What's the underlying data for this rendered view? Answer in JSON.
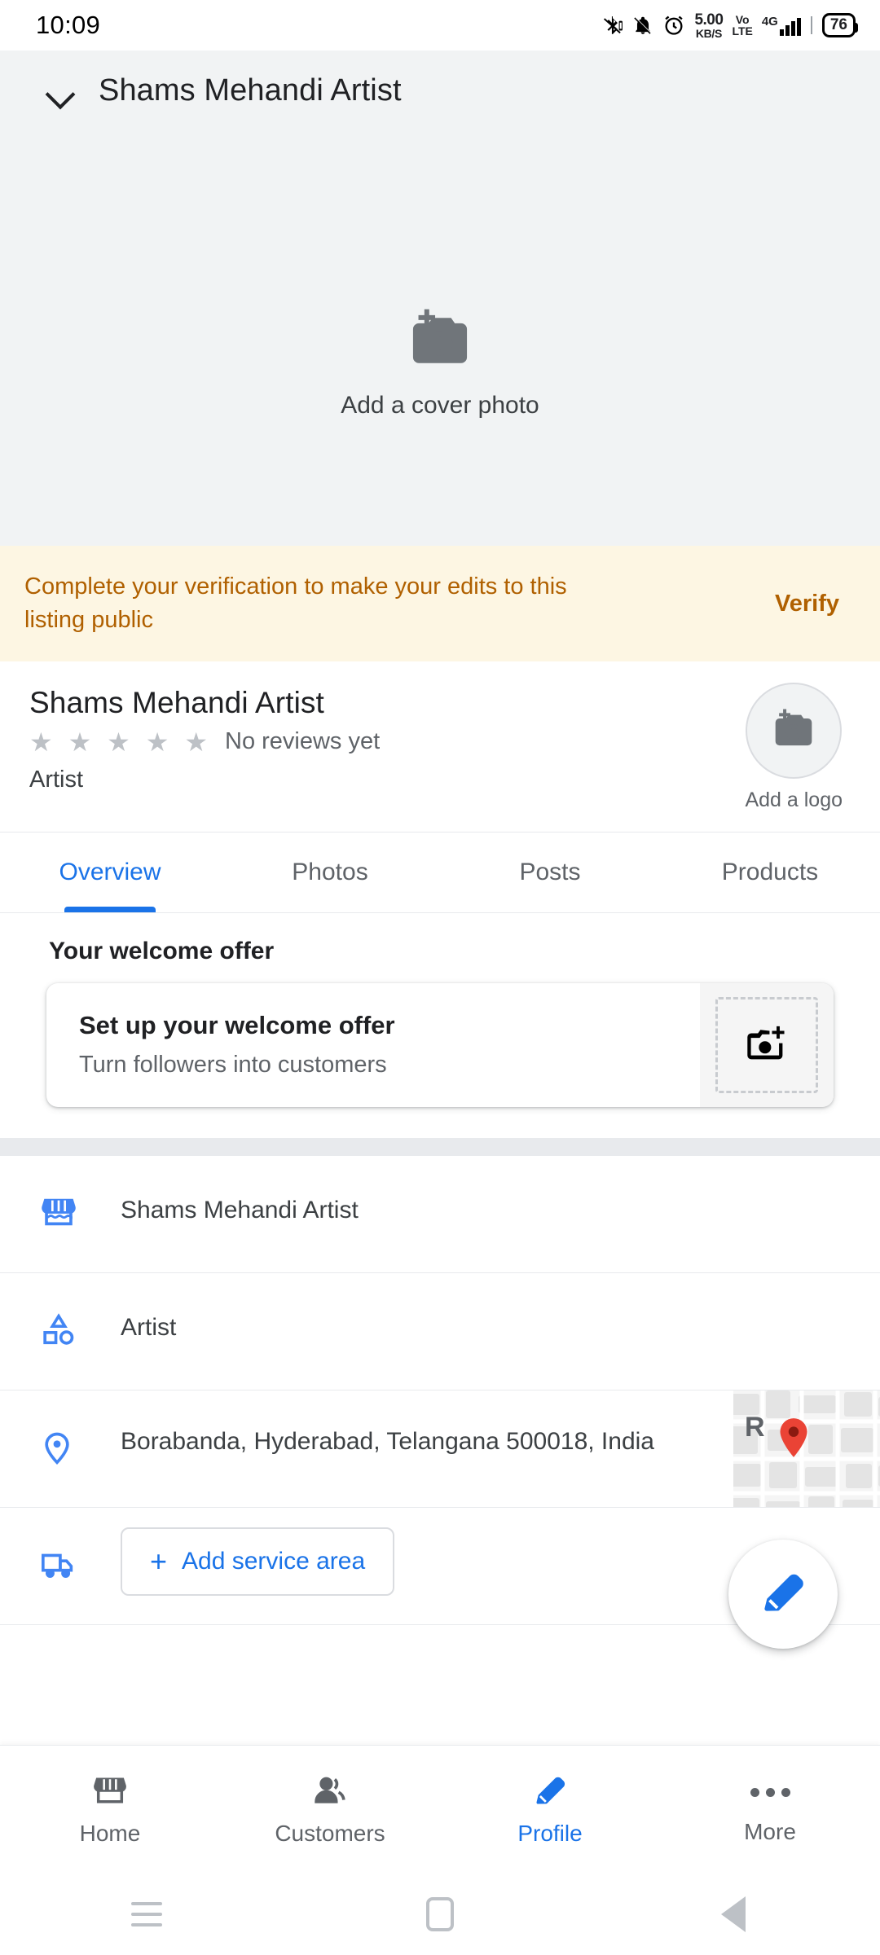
{
  "status_bar": {
    "time": "10:09",
    "network_speed_value": "5.00",
    "network_speed_unit": "KB/S",
    "volte_top": "Vo",
    "volte_bottom": "LTE",
    "network_type": "4G",
    "battery": "76",
    "icons": [
      "bluetooth-icon",
      "silent-bell-icon",
      "alarm-icon",
      "signal-bars-icon",
      "battery-icon"
    ]
  },
  "app_bar": {
    "title": "Shams Mehandi Artist",
    "chevron": "chevron-down-icon"
  },
  "cover": {
    "cta_label": "Add a cover photo",
    "icon": "add-photo-camera-icon",
    "background": "#f1f3f4"
  },
  "verification_banner": {
    "message": "Complete your verification to make your edits to this listing public",
    "action_label": "Verify",
    "background": "#fdf6e3",
    "text_color": "#b06000"
  },
  "business_header": {
    "name": "Shams Mehandi Artist",
    "stars": "★ ★ ★ ★ ★",
    "rating_text": "No reviews yet",
    "category": "Artist",
    "logo_caption": "Add a logo",
    "logo_icon": "add-photo-camera-icon"
  },
  "tabs": [
    {
      "label": "Overview",
      "active": true
    },
    {
      "label": "Photos",
      "active": false
    },
    {
      "label": "Posts",
      "active": false
    },
    {
      "label": "Products",
      "active": false
    }
  ],
  "welcome_offer": {
    "section_title": "Your welcome offer",
    "card_title": "Set up your welcome offer",
    "card_subtitle": "Turn followers into customers",
    "thumb_icon": "add-photo-camera-icon"
  },
  "info_rows": [
    {
      "icon": "storefront-icon",
      "text": "Shams Mehandi Artist"
    },
    {
      "icon": "category-shapes-icon",
      "text": "Artist"
    },
    {
      "icon": "location-pin-icon",
      "text": "Borabanda, Hyderabad, Telangana 500018, India",
      "map_label": "R",
      "map_marker": "map-marker-icon"
    },
    {
      "icon": "delivery-truck-icon",
      "button_label": "Add service area",
      "button_plus": "+"
    }
  ],
  "fab": {
    "icon": "edit-pencil-icon",
    "color": "#1a73e8"
  },
  "bottom_nav": [
    {
      "label": "Home",
      "icon": "storefront-icon",
      "active": false
    },
    {
      "label": "Customers",
      "icon": "people-icon",
      "active": false
    },
    {
      "label": "Profile",
      "icon": "edit-pencil-icon",
      "active": true
    },
    {
      "label": "More",
      "icon": "more-dots-icon",
      "active": false
    }
  ],
  "system_nav": [
    {
      "icon": "recents-icon"
    },
    {
      "icon": "home-icon"
    },
    {
      "icon": "back-icon"
    }
  ],
  "colors": {
    "accent": "#1a73e8",
    "warning_text": "#b06000",
    "warning_bg": "#fdf6e3",
    "surface_grey": "#f1f3f4"
  }
}
